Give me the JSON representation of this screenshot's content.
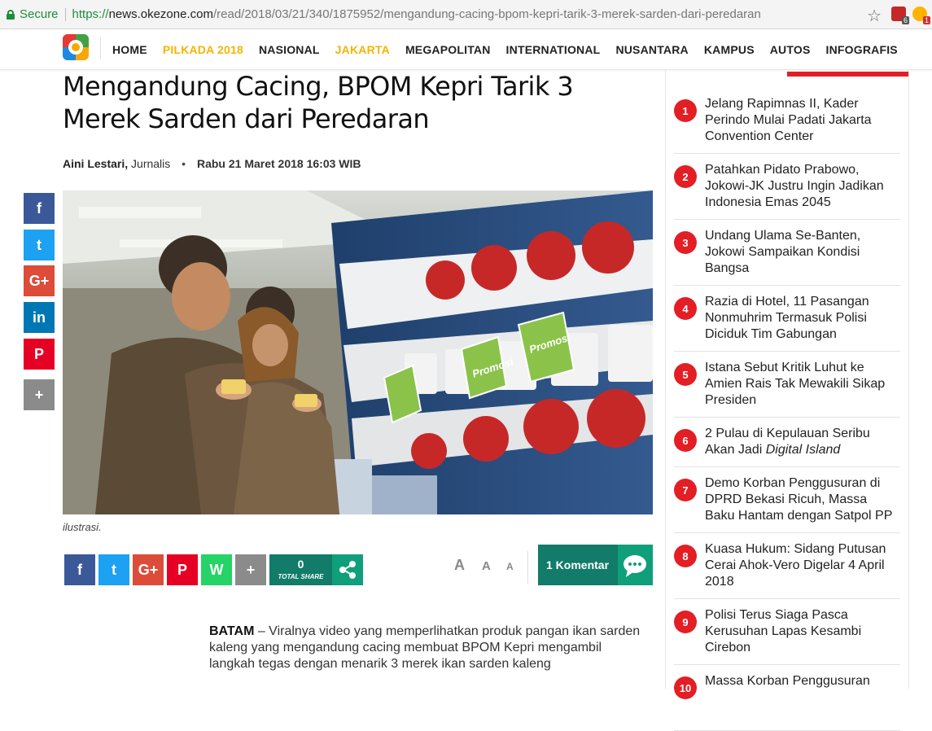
{
  "browser": {
    "secure_label": "Secure",
    "url_proto": "https://",
    "url_host": "news.okezone.com",
    "url_path": "/read/2018/03/21/340/1875952/mengandung-cacing-bpom-kepri-tarik-3-merek-sarden-dari-peredaran",
    "ext1_count": "6",
    "ext2_count": "1"
  },
  "nav": {
    "items": [
      {
        "label": "HOME",
        "highlight": false
      },
      {
        "label": "PILKADA 2018",
        "highlight": true
      },
      {
        "label": "NASIONAL",
        "highlight": false
      },
      {
        "label": "JAKARTA",
        "highlight": true
      },
      {
        "label": "MEGAPOLITAN",
        "highlight": false
      },
      {
        "label": "INTERNATIONAL",
        "highlight": false
      },
      {
        "label": "NUSANTARA",
        "highlight": false
      },
      {
        "label": "KAMPUS",
        "highlight": false
      },
      {
        "label": "AUTOS",
        "highlight": false
      },
      {
        "label": "INFOGRAFIS",
        "highlight": false
      }
    ]
  },
  "article": {
    "title": "Mengandung Cacing, BPOM Kepri Tarik 3 Merek Sarden dari Peredaran",
    "author": "Aini Lestari,",
    "author_role": "Jurnalis",
    "date": "Rabu 21 Maret 2018 16:03 WIB",
    "image_promo_text": "Promosi",
    "caption": "ilustrasi.",
    "total_share": "0",
    "total_share_label": "TOTAL SHARE",
    "comments_label": "1 Komentar",
    "font_size_labels": [
      "A",
      "A",
      "A"
    ],
    "body_lead": "BATAM",
    "body_text": " – Viralnya video yang memperlihatkan produk pangan ikan sarden kaleng yang mengandung cacing membuat BPOM Kepri mengambil langkah tegas dengan menarik 3 merek ikan sarden kaleng"
  },
  "share_side": [
    {
      "icon": "facebook-icon",
      "glyph": "f",
      "color": "#3b5998"
    },
    {
      "icon": "twitter-icon",
      "glyph": "t",
      "color": "#1da1f2"
    },
    {
      "icon": "google-plus-icon",
      "glyph": "G+",
      "color": "#dd4b39"
    },
    {
      "icon": "linkedin-icon",
      "glyph": "in",
      "color": "#0077b5"
    },
    {
      "icon": "pinterest-icon",
      "glyph": "P",
      "color": "#e60023"
    },
    {
      "icon": "more-share-icon",
      "glyph": "+",
      "color": "#8b8b8b"
    }
  ],
  "share_bottom": [
    {
      "icon": "facebook-icon",
      "glyph": "f",
      "color": "#3b5998"
    },
    {
      "icon": "twitter-icon",
      "glyph": "t",
      "color": "#1da1f2"
    },
    {
      "icon": "google-plus-icon",
      "glyph": "G+",
      "color": "#dd4b39"
    },
    {
      "icon": "pinterest-icon",
      "glyph": "P",
      "color": "#e60023"
    },
    {
      "icon": "whatsapp-icon",
      "glyph": "W",
      "color": "#25d366"
    },
    {
      "icon": "more-share-icon",
      "glyph": "+",
      "color": "#8b8b8b"
    }
  ],
  "popular": [
    {
      "num": "1",
      "title": "Jelang Rapimnas II, Kader Perindo Mulai Padati Jakarta Convention Center"
    },
    {
      "num": "2",
      "title": "Patahkan Pidato Prabowo, Jokowi-JK Justru Ingin Jadikan Indonesia Emas 2045"
    },
    {
      "num": "3",
      "title": "Undang Ulama Se-Banten, Jokowi Sampaikan Kondisi Bangsa"
    },
    {
      "num": "4",
      "title": "Razia di Hotel, 11 Pasangan Nonmuhrim Termasuk Polisi Diciduk Tim Gabungan"
    },
    {
      "num": "5",
      "title": "Istana Sebut Kritik Luhut ke Amien Rais Tak Mewakili Sikap Presiden"
    },
    {
      "num": "6",
      "title": "2 Pulau di Kepulauan Seribu Akan Jadi Digital Island"
    },
    {
      "num": "7",
      "title": "Demo Korban Penggusuran di DPRD Bekasi Ricuh, Massa Baku Hantam dengan Satpol PP"
    },
    {
      "num": "8",
      "title": "Kuasa Hukum: Sidang Putusan Cerai Ahok-Vero Digelar 4 April 2018"
    },
    {
      "num": "9",
      "title": "Polisi Terus Siaga Pasca Kerusuhan Lapas Kesambi Cirebon"
    },
    {
      "num": "10",
      "title": "Massa Korban Penggusuran"
    }
  ]
}
